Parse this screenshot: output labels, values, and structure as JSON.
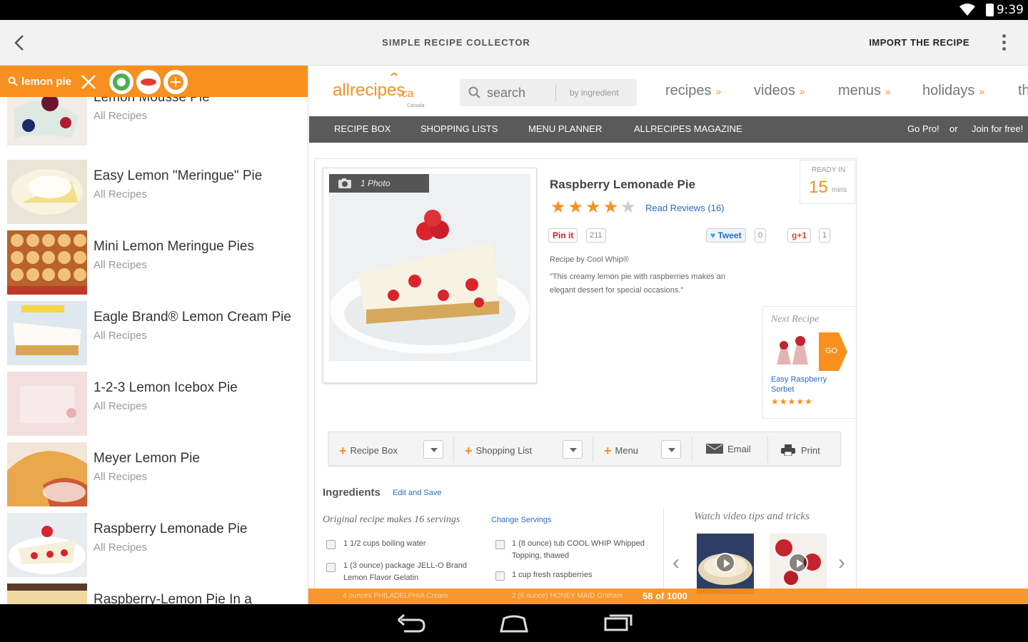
{
  "status": {
    "time": "9:39"
  },
  "appbar": {
    "title": "SIMPLE RECIPE COLLECTOR",
    "import_label": "IMPORT THE RECIPE"
  },
  "search": {
    "query": "lemon pie"
  },
  "results": [
    {
      "name": "Lemon Mousse Pie",
      "source": "All Recipes"
    },
    {
      "name": "Easy Lemon \"Meringue\" Pie",
      "source": "All Recipes"
    },
    {
      "name": "Mini Lemon Meringue Pies",
      "source": "All Recipes"
    },
    {
      "name": "Eagle Brand® Lemon Cream Pie",
      "source": "All Recipes"
    },
    {
      "name": "1-2-3 Lemon Icebox Pie",
      "source": "All Recipes"
    },
    {
      "name": "Meyer Lemon Pie",
      "source": "All Recipes"
    },
    {
      "name": "Raspberry Lemonade Pie",
      "source": "All Recipes"
    },
    {
      "name": "Raspberry-Lemon Pie In a",
      "source": ""
    }
  ],
  "site": {
    "logo_text": "allrecipes",
    "logo_suffix": ".ca",
    "logo_sub": "Canada",
    "search_placeholder": "search",
    "by_ingredient": "by ingredient",
    "nav": [
      "recipes",
      "videos",
      "menus",
      "holidays",
      "th"
    ],
    "subnav": [
      "RECIPE BOX",
      "SHOPPING LISTS",
      "MENU PLANNER",
      "ALLRECIPES MAGAZINE"
    ],
    "go_pro": "Go Pro!",
    "or": "or",
    "join": "Join for free!"
  },
  "recipe": {
    "title": "Raspberry Lemonade Pie",
    "photo_label": "1 Photo",
    "ready_label": "READY IN",
    "ready_value": "15",
    "ready_unit": "mins",
    "rating": 4,
    "reviews": "Read Reviews (16)",
    "pin_label": "Pin it",
    "pin_count": "211",
    "tweet_label": "Tweet",
    "tweet_count": "0",
    "gplus_label": "g+1",
    "gplus_count": "1",
    "by": "Recipe by Cool Whip®",
    "description": "\"This creamy lemon pie with raspberries makes an elegant dessert for special occasions.\""
  },
  "next_recipe": {
    "heading": "Next Recipe",
    "go": "GO",
    "name": "Easy Raspberry Sorbet",
    "stars": "★★★★★"
  },
  "toolbar": {
    "recipe_box": "Recipe Box",
    "shopping_list": "Shopping List",
    "menu": "Menu",
    "email": "Email",
    "print": "Print"
  },
  "ingredients": {
    "heading": "Ingredients",
    "edit": "Edit and Save",
    "original": "Original recipe makes 16 servings",
    "change": "Change Servings",
    "items": [
      "1 1/2 cups boiling water",
      "1 (3 ounce) package JELL-O Brand Lemon Flavor Gelatin",
      "1 (8 ounce) tub COOL WHIP Whipped Topping, thawed",
      "1 cup fresh raspberries"
    ],
    "hidden_items": [
      "4 ounces PHILADELPHIA Cream",
      "2 (6 ounce) HONEY MAID Graham"
    ]
  },
  "videos": {
    "heading": "Watch video tips and tricks"
  },
  "pager": {
    "text": "58 of 1000"
  },
  "colors": {
    "accent": "#f7901e",
    "link": "#2a6bbd",
    "subnav": "#5a5a5a"
  }
}
